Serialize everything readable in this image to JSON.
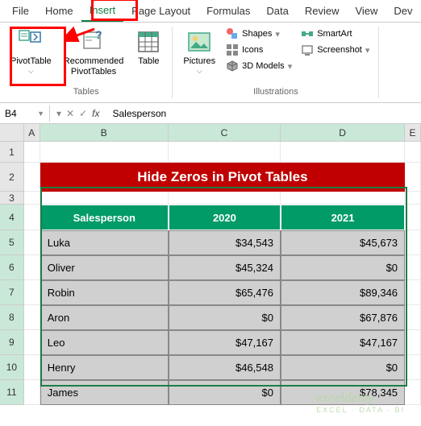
{
  "tabs": {
    "file": "File",
    "home": "Home",
    "insert": "Insert",
    "pagelayout": "Page Layout",
    "formulas": "Formulas",
    "data": "Data",
    "review": "Review",
    "view": "View",
    "dev": "Dev"
  },
  "ribbon": {
    "tables": {
      "pivot": "PivotTable",
      "recommended": "Recommended\nPivotTables",
      "table": "Table",
      "group": "Tables"
    },
    "illustrations": {
      "pictures": "Pictures",
      "shapes": "Shapes",
      "icons": "Icons",
      "models": "3D Models",
      "smartart": "SmartArt",
      "screenshot": "Screenshot",
      "group": "Illustrations"
    }
  },
  "namebox": "B4",
  "formula": "Salesperson",
  "cols": {
    "A": "A",
    "B": "B",
    "C": "C",
    "D": "D",
    "E": "E"
  },
  "banner": "Hide Zeros in Pivot Tables",
  "headers": {
    "sp": "Salesperson",
    "y1": "2020",
    "y2": "2021"
  },
  "rows": [
    {
      "name": "Luka",
      "y1": "$34,543",
      "y2": "$45,673"
    },
    {
      "name": "Oliver",
      "y1": "$45,324",
      "y2": "$0"
    },
    {
      "name": "Robin",
      "y1": "$65,476",
      "y2": "$89,346"
    },
    {
      "name": "Aron",
      "y1": "$0",
      "y2": "$67,876"
    },
    {
      "name": "Leo",
      "y1": "$47,167",
      "y2": "$47,167"
    },
    {
      "name": "Henry",
      "y1": "$46,548",
      "y2": "$0"
    },
    {
      "name": "James",
      "y1": "$0",
      "y2": "$78,345"
    }
  ],
  "watermark": {
    "main": "exceldemy",
    "sub": "EXCEL · DATA · BI"
  },
  "chart_data": {
    "type": "table",
    "title": "Hide Zeros in Pivot Tables",
    "columns": [
      "Salesperson",
      "2020",
      "2021"
    ],
    "rows": [
      [
        "Luka",
        34543,
        45673
      ],
      [
        "Oliver",
        45324,
        0
      ],
      [
        "Robin",
        65476,
        89346
      ],
      [
        "Aron",
        0,
        67876
      ],
      [
        "Leo",
        47167,
        47167
      ],
      [
        "Henry",
        46548,
        0
      ],
      [
        "James",
        0,
        78345
      ]
    ]
  }
}
